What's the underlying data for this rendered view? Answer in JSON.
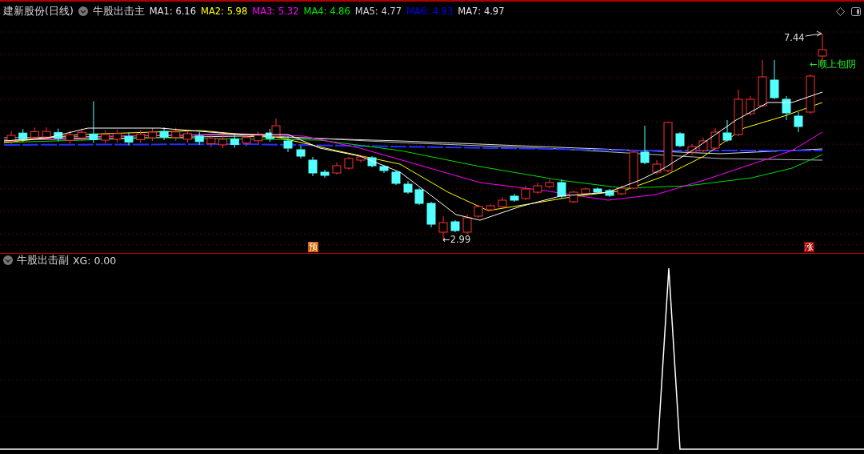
{
  "header": {
    "stock_title": "建新股份(日线)",
    "indicator_name": "牛股出击主",
    "ma_values": [
      {
        "label": "MA1: 6.16",
        "color": "#e8e8e8"
      },
      {
        "label": "MA2: 5.98",
        "color": "#ffff00"
      },
      {
        "label": "MA3: 5.32",
        "color": "#ff00ff"
      },
      {
        "label": "MA4: 4.86",
        "color": "#00ee00"
      },
      {
        "label": "MA5: 4.77",
        "color": "#d8d8d8"
      },
      {
        "label": "MA6: 4.93",
        "color": "#0000ff"
      },
      {
        "label": "MA7: 4.97",
        "color": "#e8e8e8"
      }
    ]
  },
  "main_chart": {
    "high_label": "7.44",
    "low_label": "←2.99",
    "signal_label": "←顺上包阴",
    "markers": [
      {
        "label": "预",
        "kind": "forecast"
      },
      {
        "label": "涨",
        "kind": "rise"
      }
    ]
  },
  "sub_panel": {
    "indicator_name": "牛股出击副",
    "reading": "XG: 0.00"
  }
}
